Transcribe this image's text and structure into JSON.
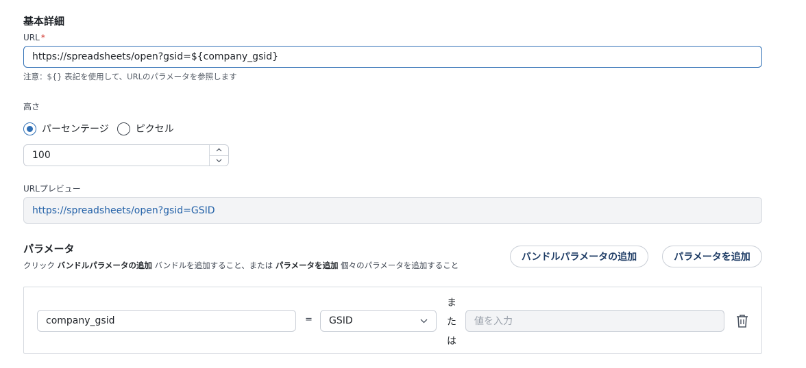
{
  "section": {
    "title": "基本詳細"
  },
  "url": {
    "label": "URL",
    "required_mark": "*",
    "value": "https://spreadsheets/open?gsid=${company_gsid}",
    "note": "注意：${} 表記を使用して、URLのパラメータを参照します"
  },
  "height": {
    "label": "高さ",
    "options": [
      {
        "label": "パーセンテージ",
        "checked": true
      },
      {
        "label": "ピクセル",
        "checked": false
      }
    ],
    "value": "100",
    "up_glyph": "⌃",
    "down_glyph": "⌄"
  },
  "preview": {
    "label": "URLプレビュー",
    "value": "https://spreadsheets/open?gsid=GSID"
  },
  "params": {
    "title": "パラメータ",
    "desc_1": "クリック ",
    "desc_bold_1": "バンドルパラメータの追加",
    "desc_2": " バンドルを追加すること、または ",
    "desc_bold_2": "パラメータを追加",
    "desc_3": " 個々のパラメータを追加すること",
    "add_bundle_label": "バンドルパラメータの追加",
    "add_param_label": "パラメータを追加",
    "rows": [
      {
        "name": "company_gsid",
        "equals": "=",
        "selected": "GSID",
        "or_chars": [
          "ま",
          "た",
          "は"
        ],
        "value_placeholder": "値を入力"
      }
    ]
  },
  "icons": {
    "select_chevron": "chevron-down-icon",
    "delete": "trash-icon"
  },
  "colors": {
    "accent": "#2f6fb5",
    "link": "#2462a8",
    "required": "#d0342c"
  }
}
